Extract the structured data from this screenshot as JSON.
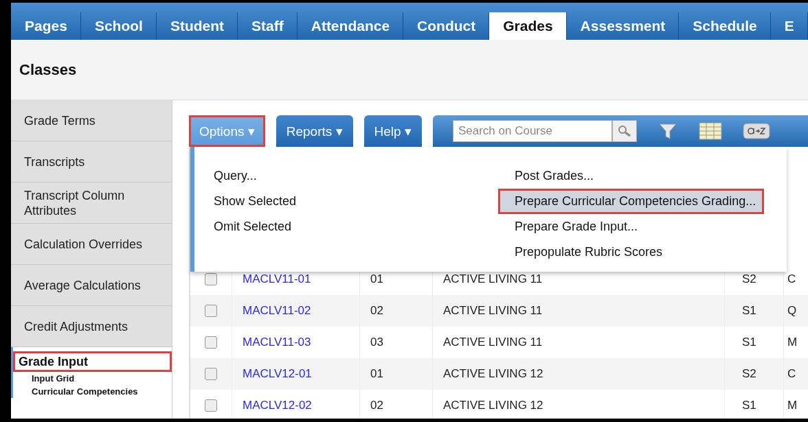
{
  "tabs": [
    {
      "label": "Pages",
      "selected": false
    },
    {
      "label": "School",
      "selected": false
    },
    {
      "label": "Student",
      "selected": false
    },
    {
      "label": "Staff",
      "selected": false
    },
    {
      "label": "Attendance",
      "selected": false
    },
    {
      "label": "Conduct",
      "selected": false
    },
    {
      "label": "Grades",
      "selected": true
    },
    {
      "label": "Assessment",
      "selected": false
    },
    {
      "label": "Schedule",
      "selected": false
    },
    {
      "label": "E",
      "selected": false
    }
  ],
  "page_title": "Classes",
  "sidebar": {
    "items": [
      {
        "label": "Grade Terms",
        "selected": false,
        "outlined": false
      },
      {
        "label": "Transcripts",
        "selected": false,
        "outlined": false
      },
      {
        "label": "Transcript Column Attributes",
        "selected": false,
        "outlined": false
      },
      {
        "label": "Calculation Overrides",
        "selected": false,
        "outlined": false
      },
      {
        "label": "Average Calculations",
        "selected": false,
        "outlined": false
      },
      {
        "label": "Credit Adjustments",
        "selected": false,
        "outlined": false
      },
      {
        "label": "Grade Input",
        "selected": true,
        "outlined": true,
        "children": [
          {
            "label": "Input Grid"
          },
          {
            "label": "Curricular Competencies"
          }
        ]
      }
    ]
  },
  "toolbar": {
    "buttons": [
      {
        "label": "Options",
        "caret": "▾",
        "selected": true,
        "outlined": true
      },
      {
        "label": "Reports",
        "caret": "▾",
        "selected": false,
        "outlined": false
      },
      {
        "label": "Help",
        "caret": "▾",
        "selected": false,
        "outlined": false
      }
    ],
    "search": {
      "placeholder": "Search on Course"
    }
  },
  "options_menu": {
    "columns": [
      [
        {
          "label": "Query...",
          "selected": false,
          "outlined": false
        },
        {
          "label": "Show Selected",
          "selected": false,
          "outlined": false
        },
        {
          "label": "Omit Selected",
          "selected": false,
          "outlined": false
        }
      ],
      [
        {
          "label": "Post Grades...",
          "selected": false,
          "outlined": false
        },
        {
          "label": "Prepare Curricular Competencies Grading...",
          "selected": true,
          "outlined": true
        },
        {
          "label": "Prepare Grade Input...",
          "selected": false,
          "outlined": false
        },
        {
          "label": "Prepopulate Rubric Scores",
          "selected": false,
          "outlined": false
        }
      ]
    ]
  },
  "table": {
    "rows": [
      {
        "checked": false,
        "course": "MACLV11-01",
        "section": "01",
        "description": "ACTIVE LIVING 11",
        "term": "S2",
        "column_6": "C"
      },
      {
        "checked": false,
        "course": "MACLV11-02",
        "section": "02",
        "description": "ACTIVE LIVING 11",
        "term": "S1",
        "column_6": "Q"
      },
      {
        "checked": false,
        "course": "MACLV11-03",
        "section": "03",
        "description": "ACTIVE LIVING 11",
        "term": "S1",
        "column_6": "M"
      },
      {
        "checked": false,
        "course": "MACLV12-01",
        "section": "01",
        "description": "ACTIVE LIVING 12",
        "term": "S2",
        "column_6": "C"
      },
      {
        "checked": false,
        "course": "MACLV12-02",
        "section": "02",
        "description": "ACTIVE LIVING 12",
        "term": "S1",
        "column_6": "M"
      }
    ]
  }
}
